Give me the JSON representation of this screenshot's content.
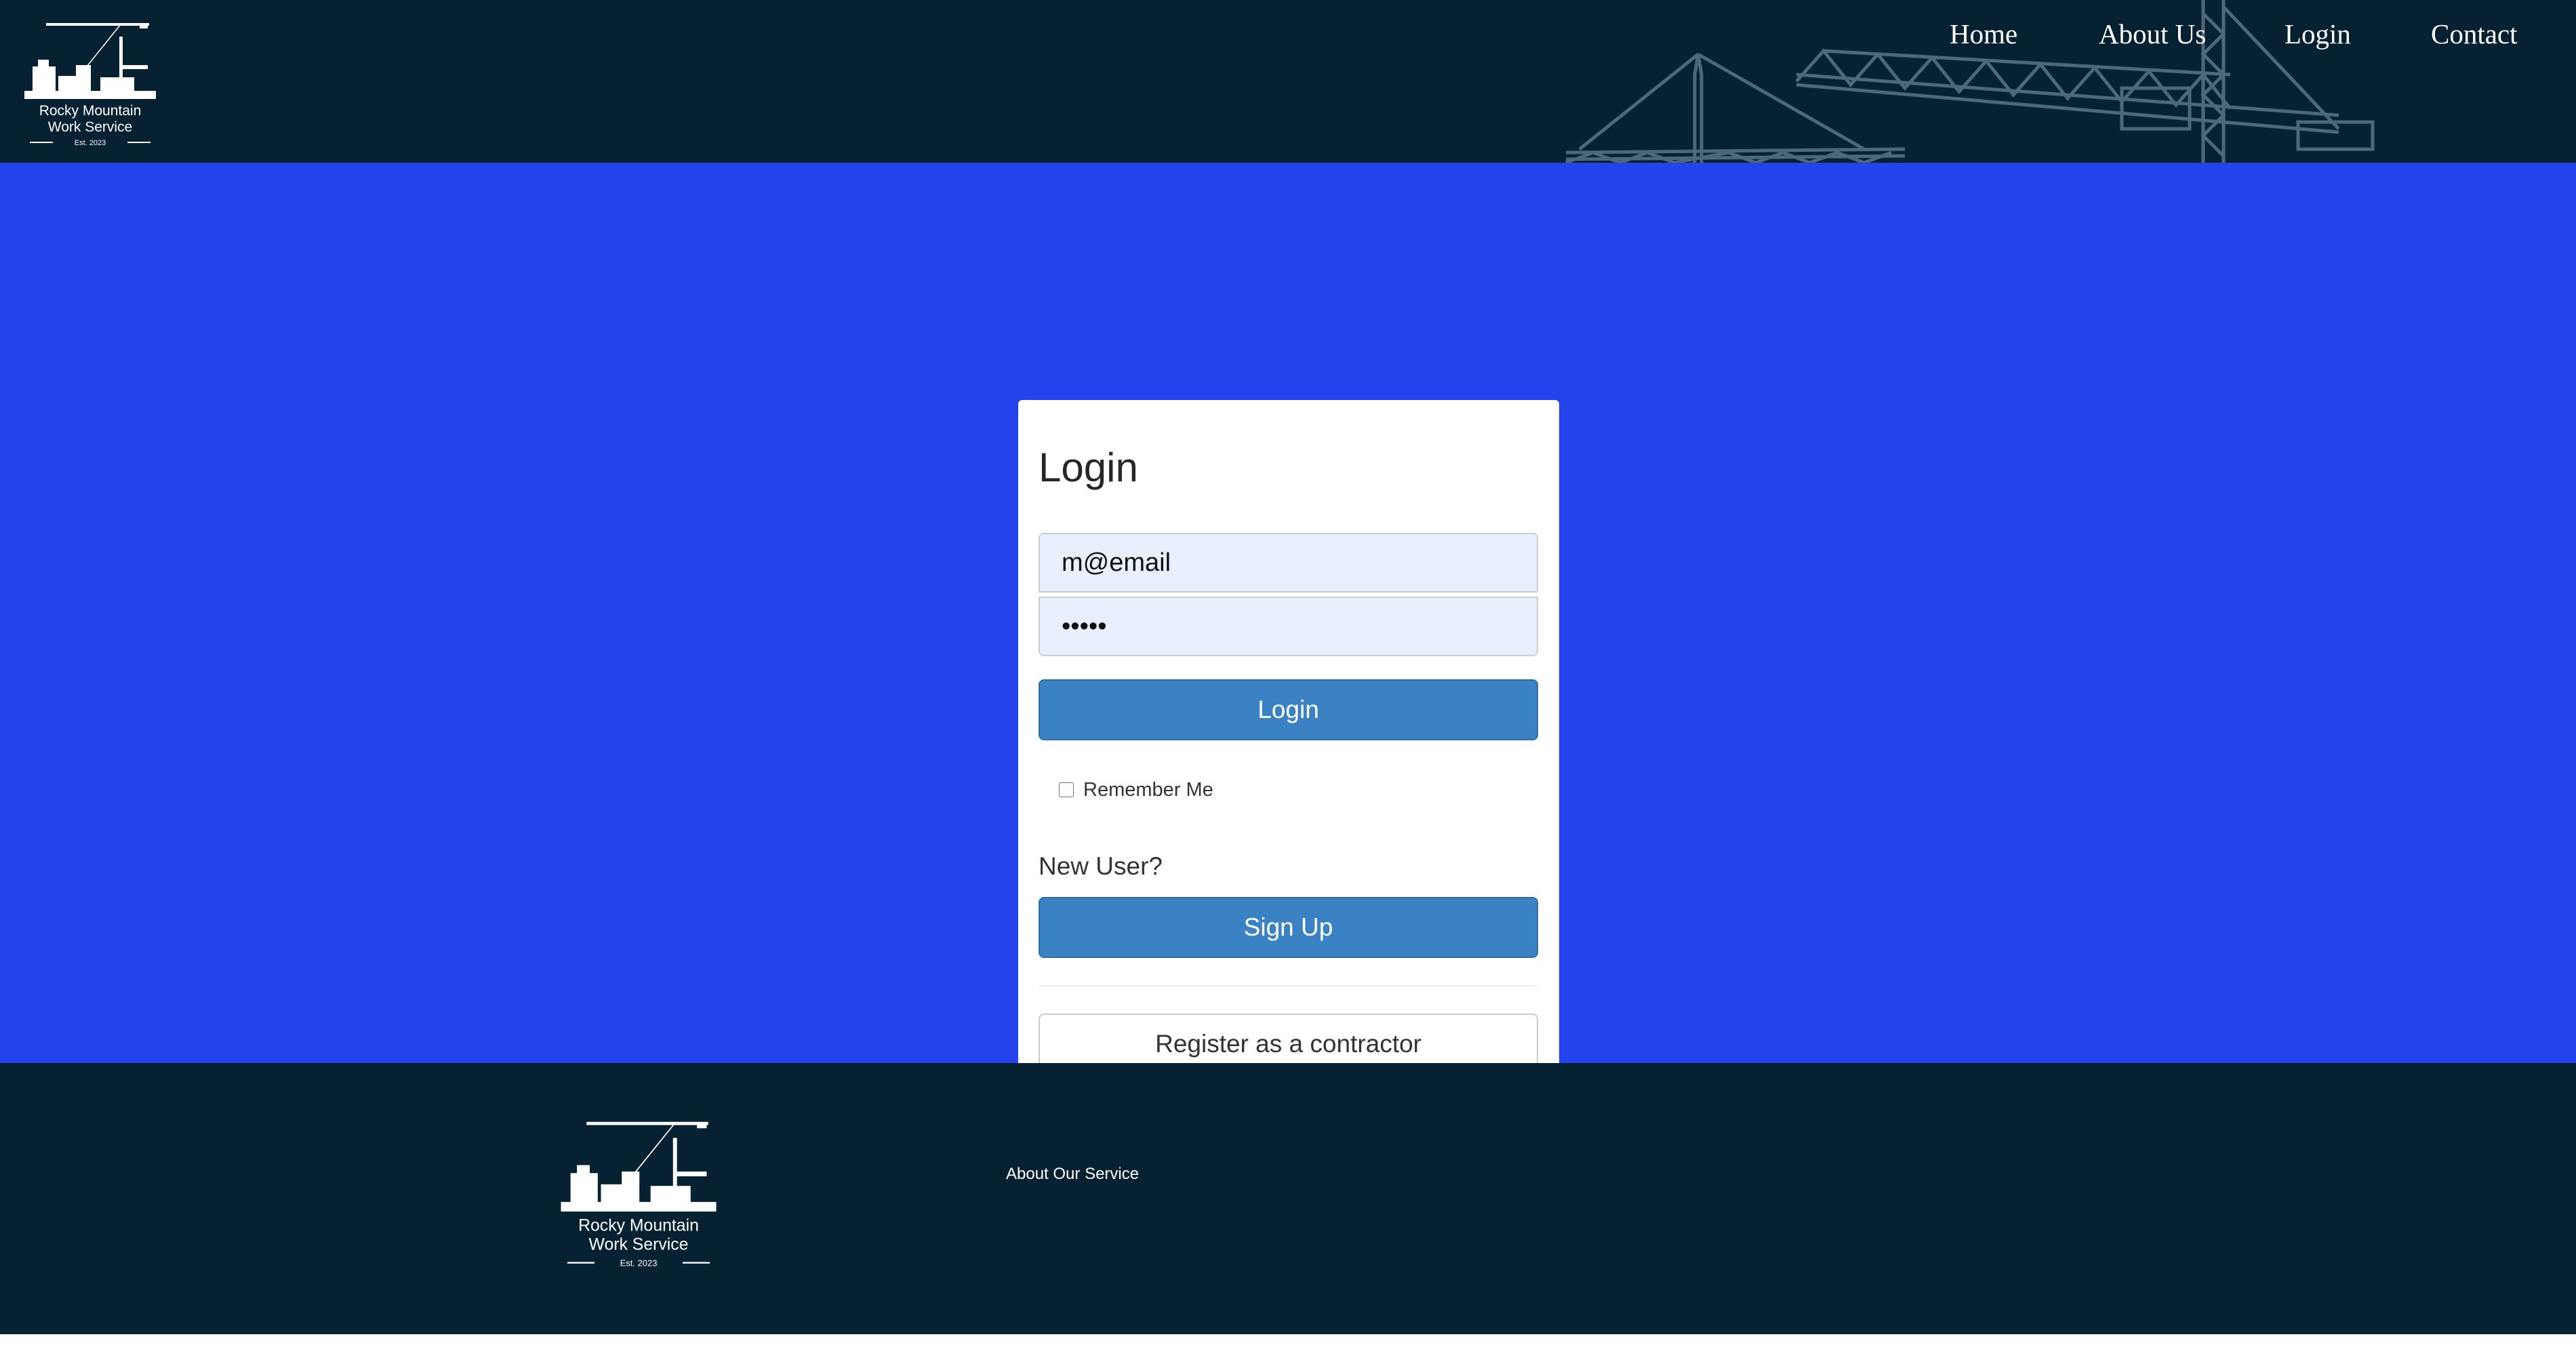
{
  "header": {
    "logo": {
      "line1": "Rocky Mountain",
      "line2": "Work Service",
      "est": "Est. 2023"
    },
    "nav": [
      {
        "label": "Home"
      },
      {
        "label": "About Us"
      },
      {
        "label": "Login"
      },
      {
        "label": "Contact"
      }
    ]
  },
  "login_form": {
    "title": "Login",
    "email_value": "m@email",
    "password_value": "•••••",
    "login_button": "Login",
    "remember_me_label": "Remember Me",
    "remember_me_checked": false,
    "new_user_text": "New User?",
    "signup_button": "Sign Up",
    "register_contractor_button": "Register as a contractor"
  },
  "footer": {
    "logo": {
      "line1": "Rocky Mountain",
      "line2": "Work Service",
      "est": "Est. 2023"
    },
    "link_about": "About Our Service"
  },
  "colors": {
    "header_bg": "#062232",
    "main_bg": "#2443ed",
    "primary_button": "#3a82c4",
    "input_bg": "#e8f0fe"
  }
}
